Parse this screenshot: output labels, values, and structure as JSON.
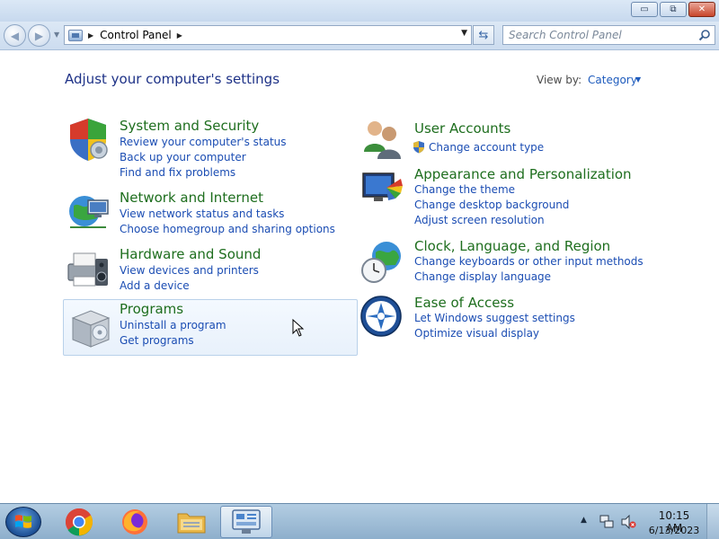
{
  "window": {
    "buttons": {
      "minimize": "▭",
      "restore": "⧉",
      "close": "✕"
    }
  },
  "navbar": {
    "back_icon": "back-arrow-icon",
    "forward_icon": "forward-arrow-icon",
    "breadcrumb": [
      "Control Panel"
    ],
    "search_placeholder": "Search Control Panel"
  },
  "main": {
    "title": "Adjust your computer's settings",
    "view_by_label": "View by:",
    "view_by_value": "Category",
    "categories_left": [
      {
        "title": "System and Security",
        "icon": "shield-icon",
        "links": [
          "Review your computer's status",
          "Back up your computer",
          "Find and fix problems"
        ]
      },
      {
        "title": "Network and Internet",
        "icon": "network-globe-icon",
        "links": [
          "View network status and tasks",
          "Choose homegroup and sharing options"
        ]
      },
      {
        "title": "Hardware and Sound",
        "icon": "printer-speaker-icon",
        "links": [
          "View devices and printers",
          "Add a device"
        ]
      },
      {
        "title": "Programs",
        "icon": "programs-box-icon",
        "links": [
          "Uninstall a program",
          "Get programs"
        ]
      }
    ],
    "categories_right": [
      {
        "title": "User Accounts",
        "icon": "users-icon",
        "links": [
          "Change account type"
        ]
      },
      {
        "title": "Appearance and Personalization",
        "icon": "monitor-palette-icon",
        "links": [
          "Change the theme",
          "Change desktop background",
          "Adjust screen resolution"
        ]
      },
      {
        "title": "Clock, Language, and Region",
        "icon": "clock-globe-icon",
        "links": [
          "Change keyboards or other input methods",
          "Change display language"
        ]
      },
      {
        "title": "Ease of Access",
        "icon": "ease-of-access-icon",
        "links": [
          "Let Windows suggest settings",
          "Optimize visual display"
        ]
      }
    ]
  },
  "taskbar": {
    "apps": [
      "Google Chrome",
      "Firefox",
      "Windows Explorer",
      "Control Panel"
    ],
    "clock_time": "10:15 AM",
    "clock_date": "6/13/2023"
  },
  "colors": {
    "link": "#1b4db3",
    "category_title": "#1e6e1e",
    "page_title": "#1e3287"
  }
}
